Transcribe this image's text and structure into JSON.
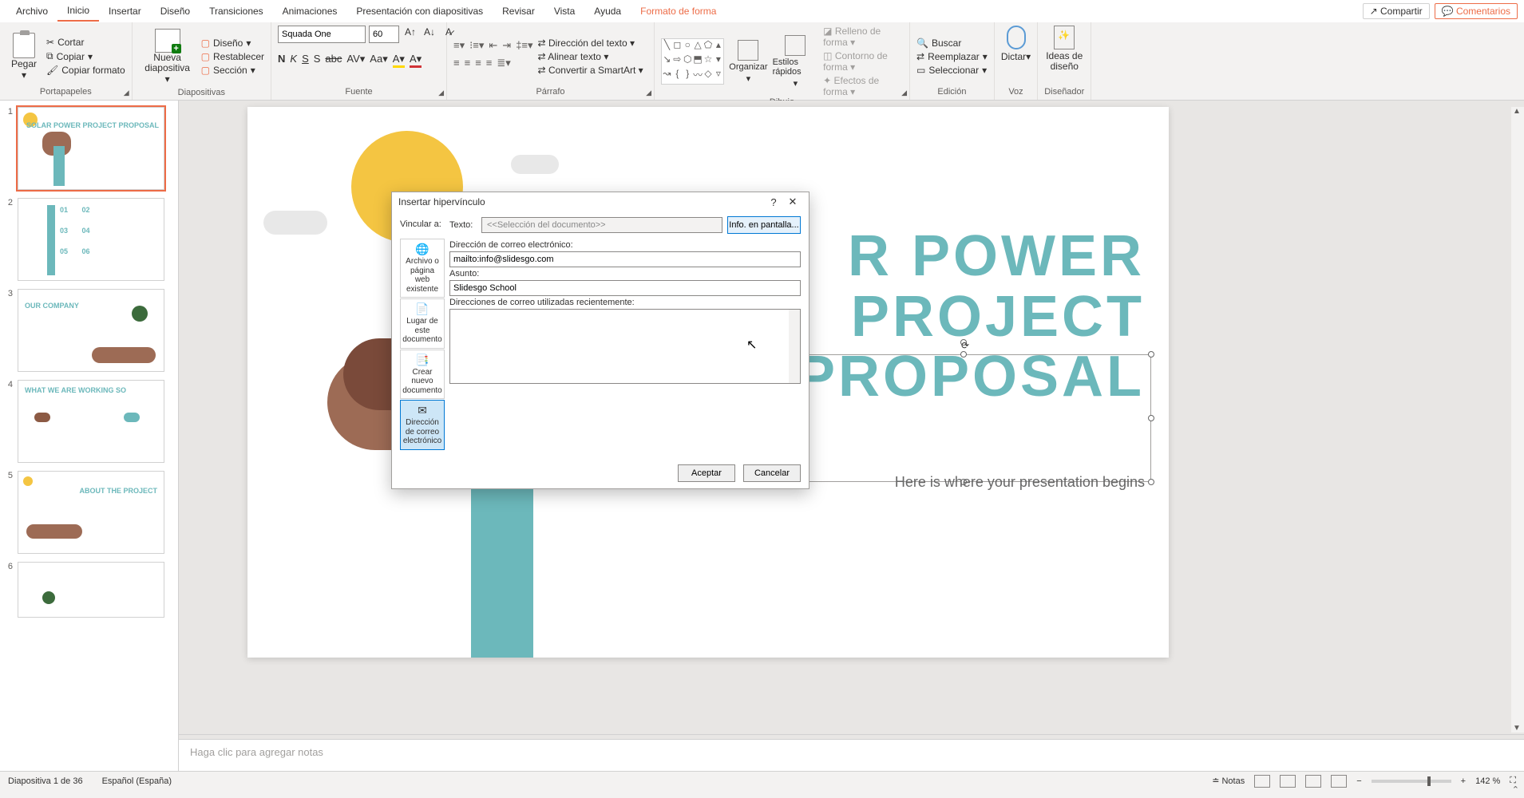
{
  "menu": {
    "archivo": "Archivo",
    "inicio": "Inicio",
    "insertar": "Insertar",
    "diseno": "Diseño",
    "transiciones": "Transiciones",
    "animaciones": "Animaciones",
    "presentacion": "Presentación con diapositivas",
    "revisar": "Revisar",
    "vista": "Vista",
    "ayuda": "Ayuda",
    "formato": "Formato de forma",
    "compartir": "Compartir",
    "comentarios": "Comentarios"
  },
  "ribbon": {
    "portapapeles": "Portapapeles",
    "pegar": "Pegar",
    "cortar": "Cortar",
    "copiar": "Copiar",
    "copiarFmt": "Copiar formato",
    "diapositivas": "Diapositivas",
    "nuevaDiap": "Nueva diapositiva",
    "layout": "Diseño",
    "restablecer": "Restablecer",
    "seccion": "Sección",
    "fuente": "Fuente",
    "fontName": "Squada One",
    "fontSize": "60",
    "parrafo": "Párrafo",
    "dirTexto": "Dirección del texto",
    "alinear": "Alinear texto",
    "smartart": "Convertir a SmartArt",
    "dibujo": "Dibujo",
    "organizar": "Organizar",
    "estilos": "Estilos rápidos",
    "relleno": "Relleno de forma",
    "contorno": "Contorno de forma",
    "efectos": "Efectos de forma",
    "edicion": "Edición",
    "buscar": "Buscar",
    "reemplazar": "Reemplazar",
    "seleccionar": "Seleccionar",
    "voz": "Voz",
    "dictar": "Dictar",
    "disenador": "Diseñador",
    "ideas": "Ideas de diseño"
  },
  "thumbs": [
    "1",
    "2",
    "3",
    "4",
    "5",
    "6"
  ],
  "slide": {
    "line1": "R POWER",
    "line2": "PROJECT",
    "line3": "PROPOSAL",
    "sub": "Here is where your presentation begins",
    "thumbTitle": "SOLAR POWER PROJECT PROPOSAL",
    "t3": "OUR COMPANY",
    "t4": "WHAT WE ARE WORKING SO",
    "t5": "ABOUT THE PROJECT"
  },
  "notes": {
    "placeholder": "Haga clic para agregar notas"
  },
  "status": {
    "slide": "Diapositiva 1 de 36",
    "lang": "Español (España)",
    "notas": "Notas",
    "zoom": "142 %"
  },
  "dialog": {
    "title": "Insertar hipervínculo",
    "vincular": "Vincular a:",
    "texto": "Texto:",
    "textoVal": "<<Selección del documento>>",
    "info": "Info. en pantalla...",
    "cat1": "Archivo o página web existente",
    "cat2": "Lugar de este documento",
    "cat3": "Crear nuevo documento",
    "cat4": "Dirección de correo electrónico",
    "emailLabel": "Dirección de correo electrónico:",
    "emailVal": "mailto:info@slidesgo.com",
    "asuntoLabel": "Asunto:",
    "asuntoVal": "Slidesgo School",
    "recientes": "Direcciones de correo utilizadas recientemente:",
    "aceptar": "Aceptar",
    "cancelar": "Cancelar"
  }
}
